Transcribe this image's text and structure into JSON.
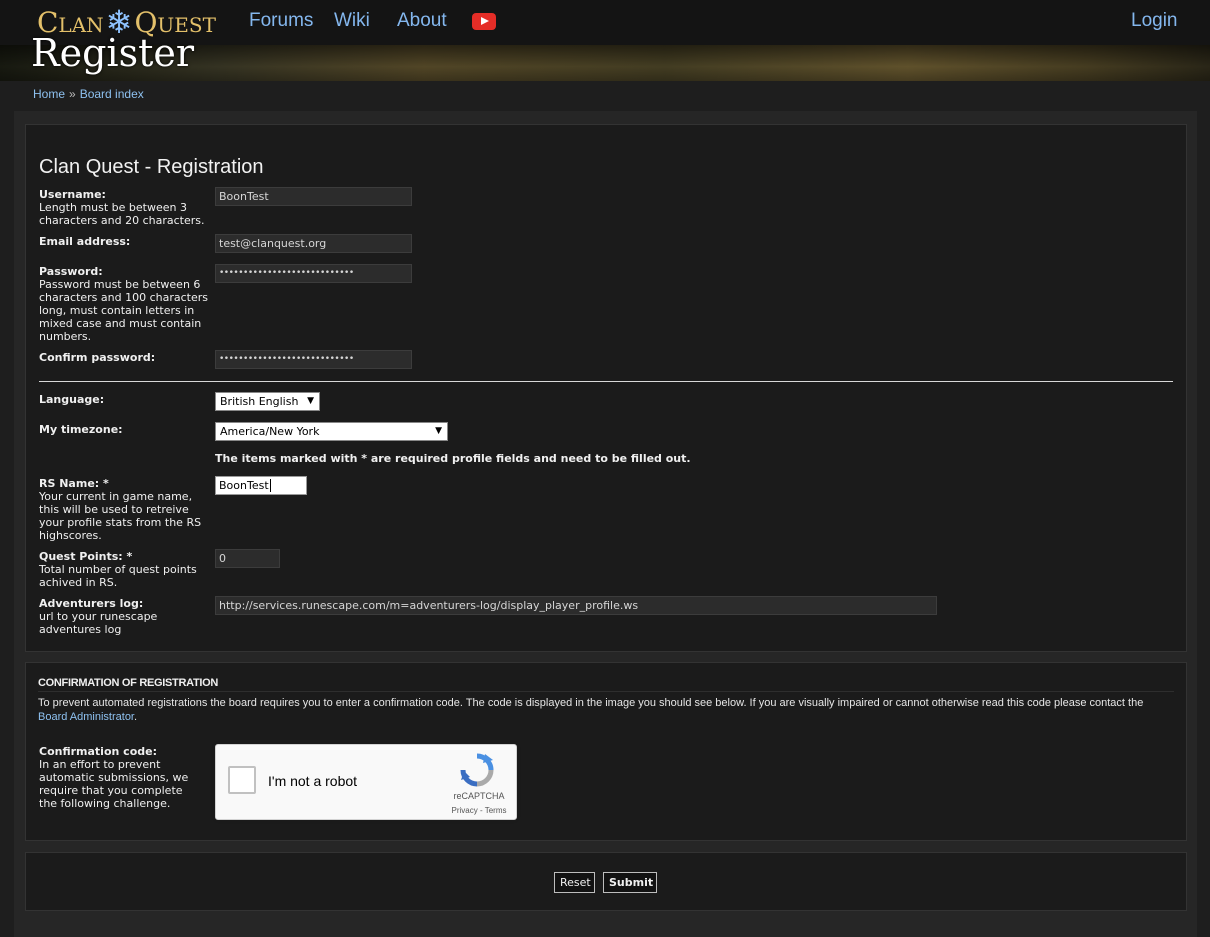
{
  "header": {
    "logo_left": "Clan",
    "logo_right": "Quest",
    "nav": [
      "Forums",
      "Wiki",
      "About"
    ],
    "youtube_icon": "youtube-icon",
    "login": "Login",
    "page_title": "Register"
  },
  "breadcrumb": {
    "home": "Home",
    "separator": "»",
    "board_index": "Board index"
  },
  "form": {
    "title": "Clan Quest - Registration",
    "username": {
      "label": "Username:",
      "explain": "Length must be between 3 characters and 20 characters.",
      "value": "BoonTest"
    },
    "email": {
      "label": "Email address:",
      "value": "test@clanquest.org"
    },
    "password": {
      "label": "Password:",
      "explain": "Password must be between 6 characters and 100 characters long, must contain letters in mixed case and must contain numbers.",
      "value": "••••••••••••••••••••••••••••"
    },
    "confirm_password": {
      "label": "Confirm password:",
      "value": "••••••••••••••••••••••••••••"
    },
    "language": {
      "label": "Language:",
      "selected": "British English"
    },
    "timezone": {
      "label": "My timezone:",
      "selected": "America/New York"
    },
    "required_note": "The items marked with * are required profile fields and need to be filled out.",
    "rs_name": {
      "label": "RS Name: *",
      "explain": "Your current in game name, this will be used to retreive your profile stats from the RS highscores.",
      "value": "BoonTest"
    },
    "quest_points": {
      "label": "Quest Points: *",
      "explain": "Total number of quest points achived in RS.",
      "value": "0"
    },
    "adventurers_log": {
      "label": "Adventurers log:",
      "explain": "url to your runescape adventures log",
      "value": "http://services.runescape.com/m=adventurers-log/display_player_profile.ws"
    }
  },
  "confirmation": {
    "title": "Confirmation of registration",
    "text": "To prevent automated registrations the board requires you to enter a confirmation code. The code is displayed in the image you should see below. If you are visually impaired or cannot otherwise read this code please contact the",
    "link": "Board Administrator",
    "text_end": ".",
    "code_label": "Confirmation code:",
    "code_explain": "In an effort to prevent automatic submissions, we require that you complete the following challenge.",
    "recaptcha": {
      "label": "I'm not a robot",
      "brand": "reCAPTCHA",
      "privacy": "Privacy",
      "terms_sep": " - ",
      "terms": "Terms"
    }
  },
  "buttons": {
    "reset": "Reset",
    "submit": "Submit"
  },
  "colors": {
    "link": "#84b7ee",
    "background": "#1e1e1e",
    "panel": "#1b1b1b",
    "logo": "#e3c06a"
  }
}
